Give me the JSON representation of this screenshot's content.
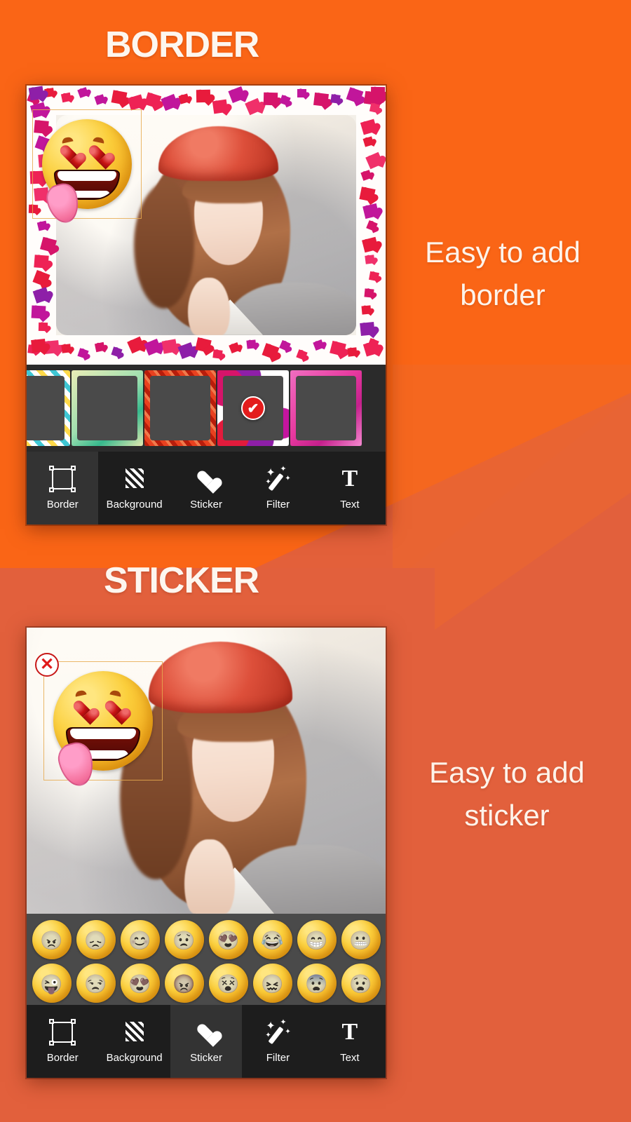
{
  "page": {
    "bg_bright": "#fa6516",
    "bg_muted": "#e2603c",
    "text_color": "#fdf3ea"
  },
  "sections": [
    {
      "heading": "BORDER",
      "tagline_line1": "Easy to add",
      "tagline_line2": "border"
    },
    {
      "heading": "STICKER",
      "tagline_line1": "Easy to add",
      "tagline_line2": "sticker"
    }
  ],
  "toolbar": {
    "items": [
      {
        "label": "Border",
        "icon": "border-frame-icon"
      },
      {
        "label": "Background",
        "icon": "hatch-square-icon"
      },
      {
        "label": "Sticker",
        "icon": "heart-icon"
      },
      {
        "label": "Filter",
        "icon": "magic-wand-icon"
      },
      {
        "label": "Text",
        "icon": "text-t-icon"
      }
    ],
    "active_border_screen": "Border",
    "active_sticker_screen": "Sticker"
  },
  "border_screen": {
    "selected_frame_index": 3,
    "selected_check_glyph": "✔",
    "frames": [
      {
        "name": "stripe-yellow-teal-frame"
      },
      {
        "name": "green-gradient-frame"
      },
      {
        "name": "red-candy-stripe-frame"
      },
      {
        "name": "heart-confetti-frame"
      },
      {
        "name": "pink-gradient-frame"
      }
    ],
    "applied_frame": "heart-confetti-frame",
    "sticker_on_photo": "heart-eyes-tongue-emoji"
  },
  "sticker_screen": {
    "sticker_on_photo": "heart-eyes-tongue-emoji",
    "close_glyph": "✕",
    "palette": {
      "row1": [
        {
          "name": "angry-squint-emoji",
          "glyph": "😠"
        },
        {
          "name": "sad-tired-emoji",
          "glyph": "😞"
        },
        {
          "name": "blush-shy-emoji",
          "glyph": "😊"
        },
        {
          "name": "worried-frown-emoji",
          "glyph": "😟"
        },
        {
          "name": "heart-eyes-tongue-emoji",
          "glyph": "😍"
        },
        {
          "name": "crying-laugh-emoji",
          "glyph": "😂"
        },
        {
          "name": "big-grin-emoji",
          "glyph": "😁"
        },
        {
          "name": "smirk-teeth-emoji",
          "glyph": "😬"
        }
      ],
      "row2": [
        {
          "name": "laughing-tongue-emoji",
          "glyph": "😜"
        },
        {
          "name": "sleepy-bored-emoji",
          "glyph": "😒"
        },
        {
          "name": "in-love-emoji",
          "glyph": "😍"
        },
        {
          "name": "very-angry-emoji",
          "glyph": "😡"
        },
        {
          "name": "dizzy-spiral-emoji",
          "glyph": "😵"
        },
        {
          "name": "frustrated-emoji",
          "glyph": "😖"
        },
        {
          "name": "shocked-eyes-emoji",
          "glyph": "😨"
        },
        {
          "name": "nervous-worried-emoji",
          "glyph": "😧"
        }
      ]
    }
  }
}
